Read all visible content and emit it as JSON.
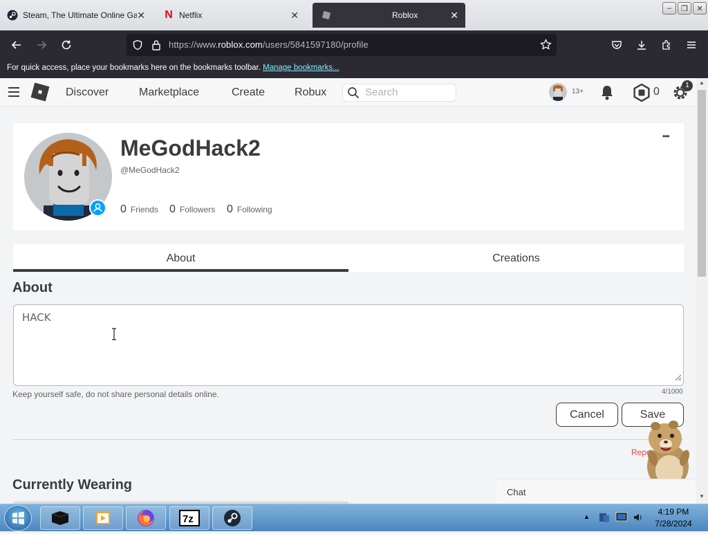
{
  "browser": {
    "tabs": [
      {
        "title": "Steam, The Ultimate Online Gam",
        "icon": "steam-icon"
      },
      {
        "title": "Netflix",
        "icon": "netflix-icon"
      },
      {
        "title": "Roblox",
        "icon": "roblox-icon"
      }
    ],
    "url_prefix": "https://www.",
    "url_domain": "roblox.com",
    "url_path": "/users/5841597180/profile",
    "bookmarks_text": "For quick access, place your bookmarks here on the bookmarks toolbar.",
    "bookmarks_link": "Manage bookmarks..."
  },
  "roblox_nav": {
    "links": [
      "Discover",
      "Marketplace",
      "Create",
      "Robux"
    ],
    "search_placeholder": "Search",
    "age_badge": "13+",
    "robux_count": "0",
    "settings_badge": "1"
  },
  "profile": {
    "display_name": "MeGodHack2",
    "username": "@MeGodHack2",
    "stats": [
      {
        "count": "0",
        "label": "Friends"
      },
      {
        "count": "0",
        "label": "Followers"
      },
      {
        "count": "0",
        "label": "Following"
      }
    ],
    "more_label": "•••"
  },
  "tabs": [
    "About",
    "Creations"
  ],
  "about": {
    "heading": "About",
    "bio": "HACK",
    "safety_note": "Keep yourself safe, do not share personal details online.",
    "char_count": "4/1000",
    "cancel_label": "Cancel",
    "save_label": "Save",
    "report_label": "Report"
  },
  "currently_wearing": "Currently Wearing",
  "chat_label": "Chat",
  "clock": {
    "time": "4:19 PM",
    "date": "7/28/2024"
  },
  "colors": {
    "accent_link": "#80ebff",
    "report": "#e04a4a",
    "online_badge": "#00a2ff"
  }
}
